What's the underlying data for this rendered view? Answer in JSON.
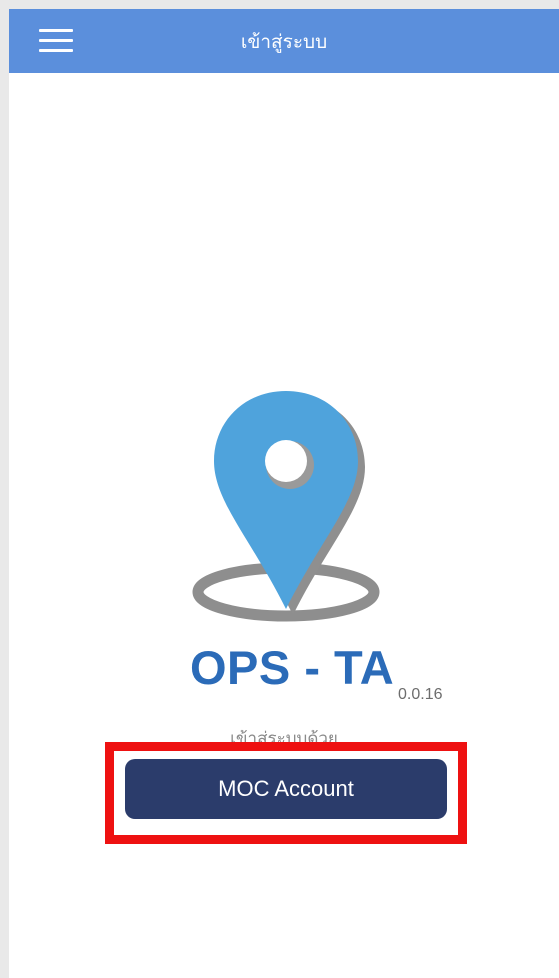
{
  "header": {
    "title": "เข้าสู่ระบบ",
    "menu_icon": "hamburger-menu-icon"
  },
  "app": {
    "name": "OPS - TA",
    "version": "0.0.16",
    "logo_icon": "map-pin-icon"
  },
  "login": {
    "label": "เข้าสู่ระบบด้วย",
    "button_label": "MOC Account"
  },
  "colors": {
    "header_bg": "#5b8fdc",
    "brand_blue": "#2b6bb8",
    "pin_blue": "#4fa3dc",
    "button_bg": "#2b3c6b",
    "highlight_red": "#ee1111"
  }
}
